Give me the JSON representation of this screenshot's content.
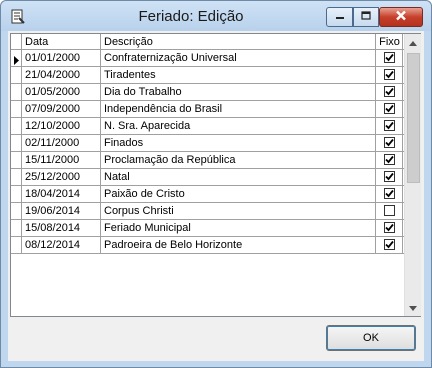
{
  "window": {
    "title": "Feriado: Edição"
  },
  "grid": {
    "columns": [
      "Data",
      "Descrição",
      "Fixo"
    ],
    "rows": [
      {
        "data": "01/01/2000",
        "descricao": "Confraternização Universal",
        "fixo": true,
        "current": true
      },
      {
        "data": "21/04/2000",
        "descricao": "Tiradentes",
        "fixo": true
      },
      {
        "data": "01/05/2000",
        "descricao": "Dia do Trabalho",
        "fixo": true
      },
      {
        "data": "07/09/2000",
        "descricao": "Independência do Brasil",
        "fixo": true
      },
      {
        "data": "12/10/2000",
        "descricao": "N. Sra. Aparecida",
        "fixo": true
      },
      {
        "data": "02/11/2000",
        "descricao": "Finados",
        "fixo": true
      },
      {
        "data": "15/11/2000",
        "descricao": "Proclamação da República",
        "fixo": true
      },
      {
        "data": "25/12/2000",
        "descricao": "Natal",
        "fixo": true
      },
      {
        "data": "18/04/2014",
        "descricao": "Paixão de Cristo",
        "fixo": true
      },
      {
        "data": "19/06/2014",
        "descricao": "Corpus Christi",
        "fixo": false
      },
      {
        "data": "15/08/2014",
        "descricao": "Feriado Municipal",
        "fixo": true
      },
      {
        "data": "08/12/2014",
        "descricao": "Padroeira de Belo Horizonte",
        "fixo": true
      }
    ]
  },
  "buttons": {
    "ok": "OK"
  },
  "icons": {
    "app": "app-icon",
    "minimize": "minimize-icon",
    "maximize": "maximize-icon",
    "close": "close-icon",
    "row_indicator": "row-indicator-icon",
    "scroll_up": "scroll-up-icon",
    "scroll_down": "scroll-down-icon"
  }
}
